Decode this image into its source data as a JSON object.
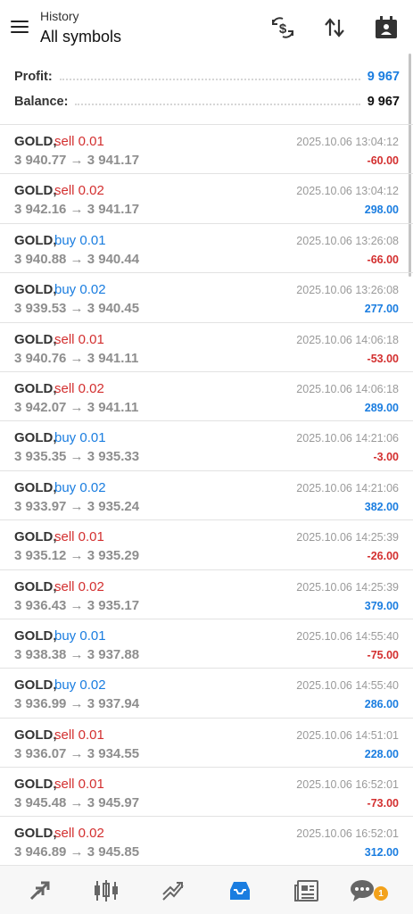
{
  "header": {
    "subtitle": "History",
    "title": "All symbols",
    "icons": [
      "currency-swap-icon",
      "sort-icon",
      "calendar-icon"
    ]
  },
  "summary": {
    "profit_label": "Profit:",
    "profit_value": "9 967",
    "balance_label": "Balance:",
    "balance_value": "9 967"
  },
  "colors": {
    "sell": "#d32f2f",
    "buy": "#1a7de0",
    "profit_positive": "#1a7de0",
    "profit_negative": "#d32f2f",
    "accent": "#1a7de0",
    "badge": "#f3a21b"
  },
  "deals": [
    {
      "symbol": "GOLD,",
      "type": "sell 0.01",
      "side": "sell",
      "time": "2025.10.06 13:04:12",
      "prices": "3 940.77 → 3 941.17",
      "profit": "-60.00",
      "sign": "neg"
    },
    {
      "symbol": "GOLD,",
      "type": "sell 0.02",
      "side": "sell",
      "time": "2025.10.06 13:04:12",
      "prices": "3 942.16 → 3 941.17",
      "profit": "298.00",
      "sign": "pos"
    },
    {
      "symbol": "GOLD,",
      "type": "buy 0.01",
      "side": "buy",
      "time": "2025.10.06 13:26:08",
      "prices": "3 940.88 → 3 940.44",
      "profit": "-66.00",
      "sign": "neg"
    },
    {
      "symbol": "GOLD,",
      "type": "buy 0.02",
      "side": "buy",
      "time": "2025.10.06 13:26:08",
      "prices": "3 939.53 → 3 940.45",
      "profit": "277.00",
      "sign": "pos"
    },
    {
      "symbol": "GOLD,",
      "type": "sell 0.01",
      "side": "sell",
      "time": "2025.10.06 14:06:18",
      "prices": "3 940.76 → 3 941.11",
      "profit": "-53.00",
      "sign": "neg"
    },
    {
      "symbol": "GOLD,",
      "type": "sell 0.02",
      "side": "sell",
      "time": "2025.10.06 14:06:18",
      "prices": "3 942.07 → 3 941.11",
      "profit": "289.00",
      "sign": "pos"
    },
    {
      "symbol": "GOLD,",
      "type": "buy 0.01",
      "side": "buy",
      "time": "2025.10.06 14:21:06",
      "prices": "3 935.35 → 3 935.33",
      "profit": "-3.00",
      "sign": "neg"
    },
    {
      "symbol": "GOLD,",
      "type": "buy 0.02",
      "side": "buy",
      "time": "2025.10.06 14:21:06",
      "prices": "3 933.97 → 3 935.24",
      "profit": "382.00",
      "sign": "pos"
    },
    {
      "symbol": "GOLD,",
      "type": "sell 0.01",
      "side": "sell",
      "time": "2025.10.06 14:25:39",
      "prices": "3 935.12 → 3 935.29",
      "profit": "-26.00",
      "sign": "neg"
    },
    {
      "symbol": "GOLD,",
      "type": "sell 0.02",
      "side": "sell",
      "time": "2025.10.06 14:25:39",
      "prices": "3 936.43 → 3 935.17",
      "profit": "379.00",
      "sign": "pos"
    },
    {
      "symbol": "GOLD,",
      "type": "buy 0.01",
      "side": "buy",
      "time": "2025.10.06 14:55:40",
      "prices": "3 938.38 → 3 937.88",
      "profit": "-75.00",
      "sign": "neg"
    },
    {
      "symbol": "GOLD,",
      "type": "buy 0.02",
      "side": "buy",
      "time": "2025.10.06 14:55:40",
      "prices": "3 936.99 → 3 937.94",
      "profit": "286.00",
      "sign": "pos"
    },
    {
      "symbol": "GOLD,",
      "type": "sell 0.01",
      "side": "sell",
      "time": "2025.10.06 14:51:01",
      "prices": "3 936.07 → 3 934.55",
      "profit": "228.00",
      "sign": "pos"
    },
    {
      "symbol": "GOLD,",
      "type": "sell 0.01",
      "side": "sell",
      "time": "2025.10.06 16:52:01",
      "prices": "3 945.48 → 3 945.97",
      "profit": "-73.00",
      "sign": "neg"
    },
    {
      "symbol": "GOLD,",
      "type": "sell 0.02",
      "side": "sell",
      "time": "2025.10.06 16:52:01",
      "prices": "3 946.89 → 3 945.85",
      "profit": "312.00",
      "sign": "pos"
    }
  ],
  "bottom_nav": {
    "items": [
      "quotes-icon",
      "chart-icon",
      "trade-icon",
      "history-icon",
      "news-icon",
      "chat-icon"
    ],
    "active": "history-icon",
    "chat_badge": "1"
  }
}
